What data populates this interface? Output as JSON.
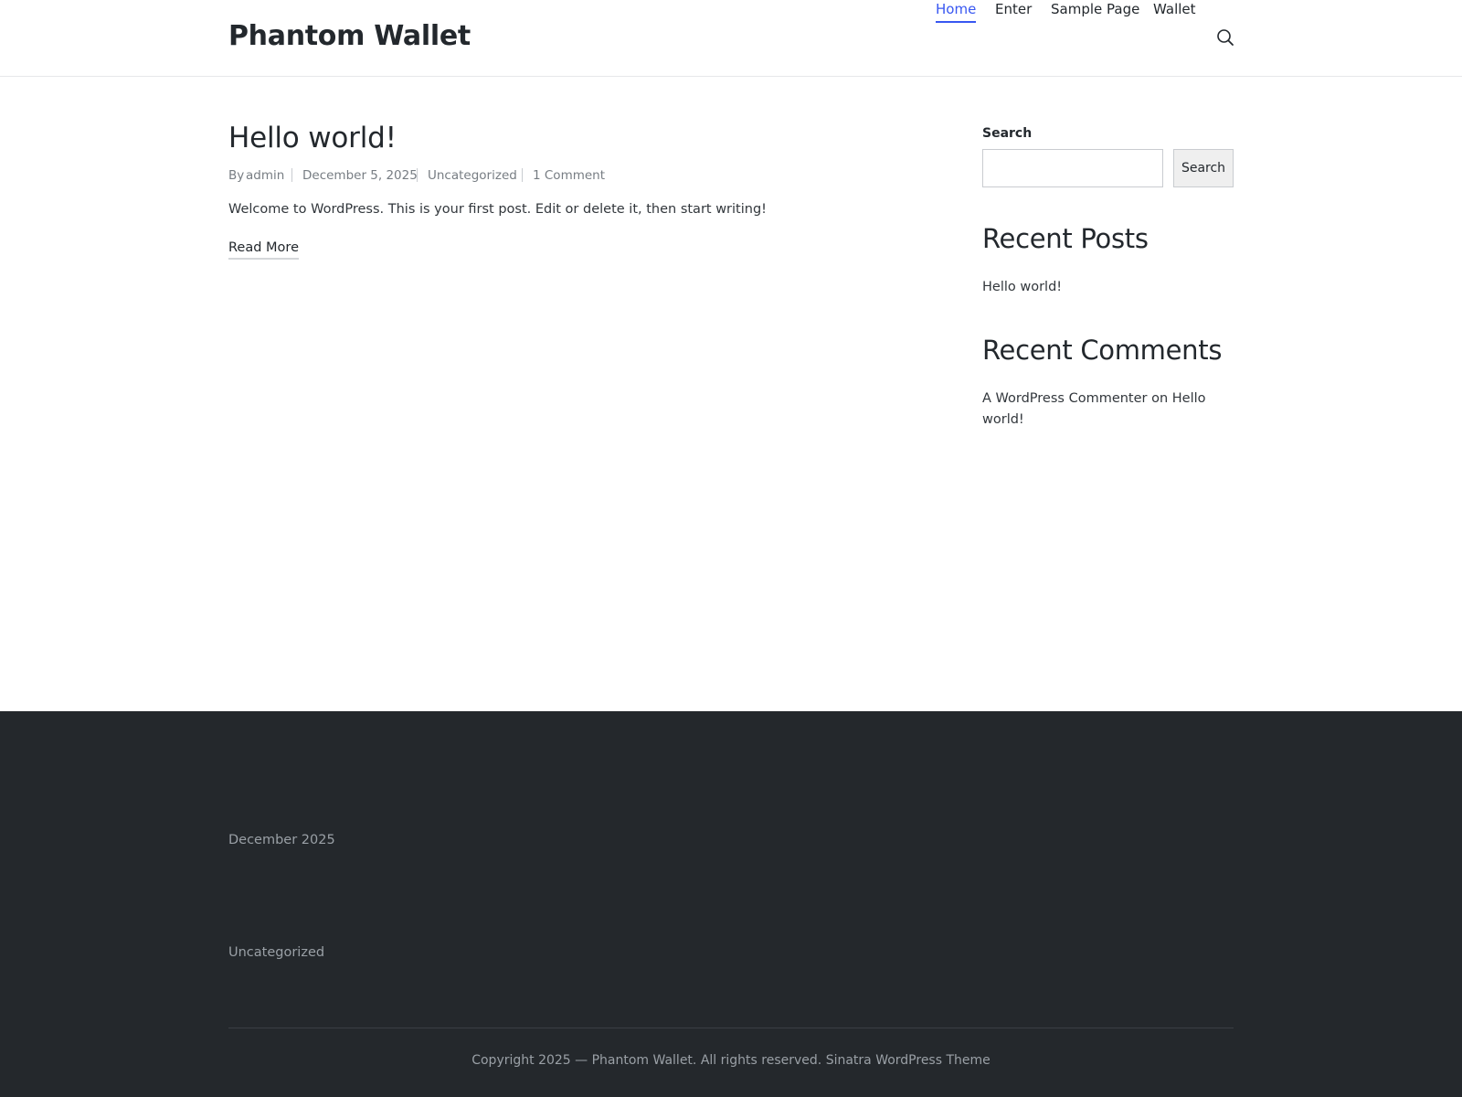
{
  "header": {
    "site_title": "Phantom Wallet",
    "nav": [
      {
        "label": "Home",
        "active": true
      },
      {
        "label": "Enter",
        "active": false
      },
      {
        "label": "Sample Page",
        "active": false
      },
      {
        "label": "Wallet",
        "active": false
      }
    ],
    "search_icon": "search-icon",
    "accent_color": "#3857f1"
  },
  "post": {
    "title": "Hello world!",
    "meta": {
      "author_prefix": "By",
      "author": "admin",
      "date": "December 5, 2025",
      "category": "Uncategorized",
      "comments": "1 Comment"
    },
    "excerpt": "Welcome to WordPress. This is your first post. Edit or delete it, then start writing!",
    "read_more": "Read More"
  },
  "sidebar": {
    "search": {
      "label": "Search",
      "value": "",
      "button_label": "Search"
    },
    "recent_posts": {
      "heading": "Recent Posts",
      "items": [
        "Hello world!"
      ]
    },
    "recent_comments": {
      "heading": "Recent Comments",
      "author": "A WordPress Commenter",
      "connector": "on",
      "post": "Hello world!"
    }
  },
  "footer": {
    "archive": "December 2025",
    "category": "Uncategorized",
    "copyright": "Copyright 2025 — Phantom Wallet. All rights reserved.",
    "theme_link": "Sinatra WordPress Theme",
    "background_color": "#24282c"
  }
}
